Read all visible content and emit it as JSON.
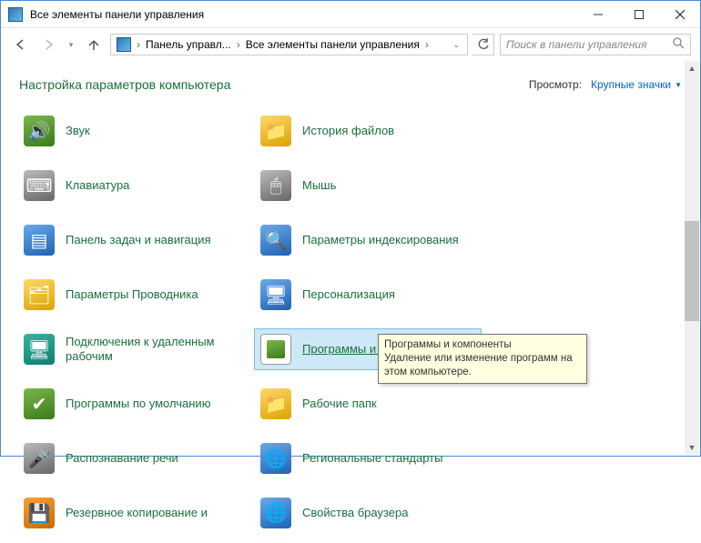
{
  "window": {
    "title": "Все элементы панели управления"
  },
  "breadcrumb": {
    "seg1": "Панель управл...",
    "seg2": "Все элементы панели управления"
  },
  "search": {
    "placeholder": "Поиск в панели управления"
  },
  "header": {
    "title": "Настройка параметров компьютера"
  },
  "view": {
    "label": "Просмотр:",
    "value": "Крупные значки"
  },
  "items": [
    {
      "label": "Звук"
    },
    {
      "label": "История файлов"
    },
    {
      "label": "Клавиатура"
    },
    {
      "label": "Мышь"
    },
    {
      "label": "Панель задач и навигация"
    },
    {
      "label": "Параметры индексирования"
    },
    {
      "label": "Параметры Проводника"
    },
    {
      "label": "Персонализация"
    },
    {
      "label": "Подключения к удаленным рабочим"
    },
    {
      "label": "Программы и компоненты"
    },
    {
      "label": "Программы по умолчанию"
    },
    {
      "label": "Рабочие папк"
    },
    {
      "label": "Распознавание речи"
    },
    {
      "label": "Региональные стандарты"
    },
    {
      "label": "Резервное копирование и"
    },
    {
      "label": "Свойства браузера"
    }
  ],
  "tooltip": {
    "title": "Программы и компоненты",
    "body": "Удаление или изменение программ на этом компьютере."
  }
}
